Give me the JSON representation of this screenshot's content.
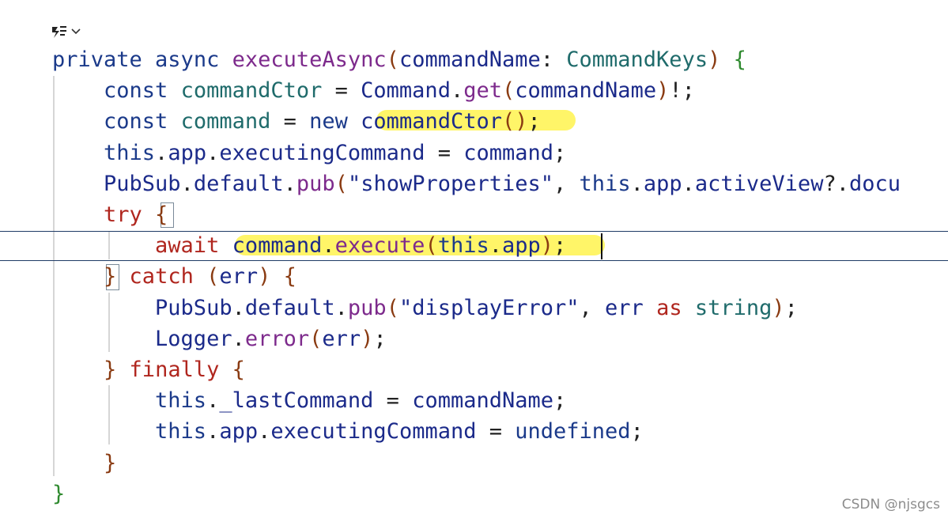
{
  "codelens": {
    "icon": "references-icon",
    "chevron": "chevron-down-icon"
  },
  "lines": [
    [
      [
        "private ",
        "t-private"
      ],
      [
        "async ",
        "t-private"
      ],
      [
        "executeAsync",
        "t-fn"
      ],
      [
        "(",
        "t-brown"
      ],
      [
        "commandName",
        "t-obj"
      ],
      [
        ": ",
        "t-op"
      ],
      [
        "CommandKeys",
        "t-type"
      ],
      [
        ")",
        "t-brown"
      ],
      [
        " ",
        "t-op"
      ],
      [
        "{",
        "t-brace-g"
      ]
    ],
    [
      [
        "    const ",
        "t-const"
      ],
      [
        "commandCtor",
        "t-local"
      ],
      [
        " = ",
        "t-op"
      ],
      [
        "Command",
        "t-obj"
      ],
      [
        ".",
        "t-op"
      ],
      [
        "get",
        "t-meth"
      ],
      [
        "(",
        "t-brown"
      ],
      [
        "commandName",
        "t-obj"
      ],
      [
        ")",
        "t-brown"
      ],
      [
        "!;",
        "t-op"
      ]
    ],
    [
      [
        "    const ",
        "t-const"
      ],
      [
        "command",
        "t-local"
      ],
      [
        " = ",
        "t-op"
      ],
      [
        "new ",
        "t-const"
      ],
      [
        "commandCtor",
        "t-obj"
      ],
      [
        "()",
        "t-brown"
      ],
      [
        ";",
        "t-op"
      ]
    ],
    [
      [
        "    this",
        "t-this"
      ],
      [
        ".",
        "t-op"
      ],
      [
        "app",
        "t-obj"
      ],
      [
        ".",
        "t-op"
      ],
      [
        "executingCommand",
        "t-obj"
      ],
      [
        " = ",
        "t-op"
      ],
      [
        "command",
        "t-obj"
      ],
      [
        ";",
        "t-op"
      ]
    ],
    [
      [
        "    PubSub",
        "t-obj"
      ],
      [
        ".",
        "t-op"
      ],
      [
        "default",
        "t-obj"
      ],
      [
        ".",
        "t-op"
      ],
      [
        "pub",
        "t-meth"
      ],
      [
        "(",
        "t-brown"
      ],
      [
        "\"showProperties\"",
        "t-str"
      ],
      [
        ", ",
        "t-op"
      ],
      [
        "this",
        "t-this"
      ],
      [
        ".",
        "t-op"
      ],
      [
        "app",
        "t-obj"
      ],
      [
        ".",
        "t-op"
      ],
      [
        "activeView",
        "t-obj"
      ],
      [
        "?.",
        "t-op"
      ],
      [
        "docu",
        "t-obj"
      ]
    ],
    [
      [
        "    try ",
        "t-red"
      ],
      [
        "{",
        "t-brown"
      ]
    ],
    [
      [
        "        await ",
        "t-red"
      ],
      [
        "command",
        "t-obj"
      ],
      [
        ".",
        "t-op"
      ],
      [
        "execute",
        "t-meth"
      ],
      [
        "(",
        "t-brown"
      ],
      [
        "this",
        "t-this"
      ],
      [
        ".",
        "t-op"
      ],
      [
        "app",
        "t-obj"
      ],
      [
        ")",
        "t-brown"
      ],
      [
        ";",
        "t-op"
      ]
    ],
    [
      [
        "    ",
        "t-op"
      ],
      [
        "}",
        "t-brown"
      ],
      [
        " catch ",
        "t-red"
      ],
      [
        "(",
        "t-brown"
      ],
      [
        "err",
        "t-obj"
      ],
      [
        ")",
        "t-brown"
      ],
      [
        " ",
        "t-op"
      ],
      [
        "{",
        "t-brown"
      ]
    ],
    [
      [
        "        PubSub",
        "t-obj"
      ],
      [
        ".",
        "t-op"
      ],
      [
        "default",
        "t-obj"
      ],
      [
        ".",
        "t-op"
      ],
      [
        "pub",
        "t-meth"
      ],
      [
        "(",
        "t-brown"
      ],
      [
        "\"displayError\"",
        "t-str"
      ],
      [
        ", ",
        "t-op"
      ],
      [
        "err",
        "t-obj"
      ],
      [
        " as ",
        "t-red"
      ],
      [
        "string",
        "t-type"
      ],
      [
        ")",
        "t-brown"
      ],
      [
        ";",
        "t-op"
      ]
    ],
    [
      [
        "        Logger",
        "t-obj"
      ],
      [
        ".",
        "t-op"
      ],
      [
        "error",
        "t-meth"
      ],
      [
        "(",
        "t-brown"
      ],
      [
        "err",
        "t-obj"
      ],
      [
        ")",
        "t-brown"
      ],
      [
        ";",
        "t-op"
      ]
    ],
    [
      [
        "    ",
        "t-op"
      ],
      [
        "}",
        "t-brown"
      ],
      [
        " finally ",
        "t-red"
      ],
      [
        "{",
        "t-brown"
      ]
    ],
    [
      [
        "        this",
        "t-this"
      ],
      [
        ".",
        "t-op"
      ],
      [
        "_lastCommand",
        "t-obj"
      ],
      [
        " = ",
        "t-op"
      ],
      [
        "commandName",
        "t-obj"
      ],
      [
        ";",
        "t-op"
      ]
    ],
    [
      [
        "        this",
        "t-this"
      ],
      [
        ".",
        "t-op"
      ],
      [
        "app",
        "t-obj"
      ],
      [
        ".",
        "t-op"
      ],
      [
        "executingCommand",
        "t-obj"
      ],
      [
        " = ",
        "t-op"
      ],
      [
        "undefined",
        "t-const"
      ],
      [
        ";",
        "t-op"
      ]
    ],
    [
      [
        "    ",
        "t-op"
      ],
      [
        "}",
        "t-brown"
      ]
    ],
    [
      [
        "}",
        "t-brace-g"
      ]
    ]
  ],
  "watermark": "CSDN @njsgcs"
}
